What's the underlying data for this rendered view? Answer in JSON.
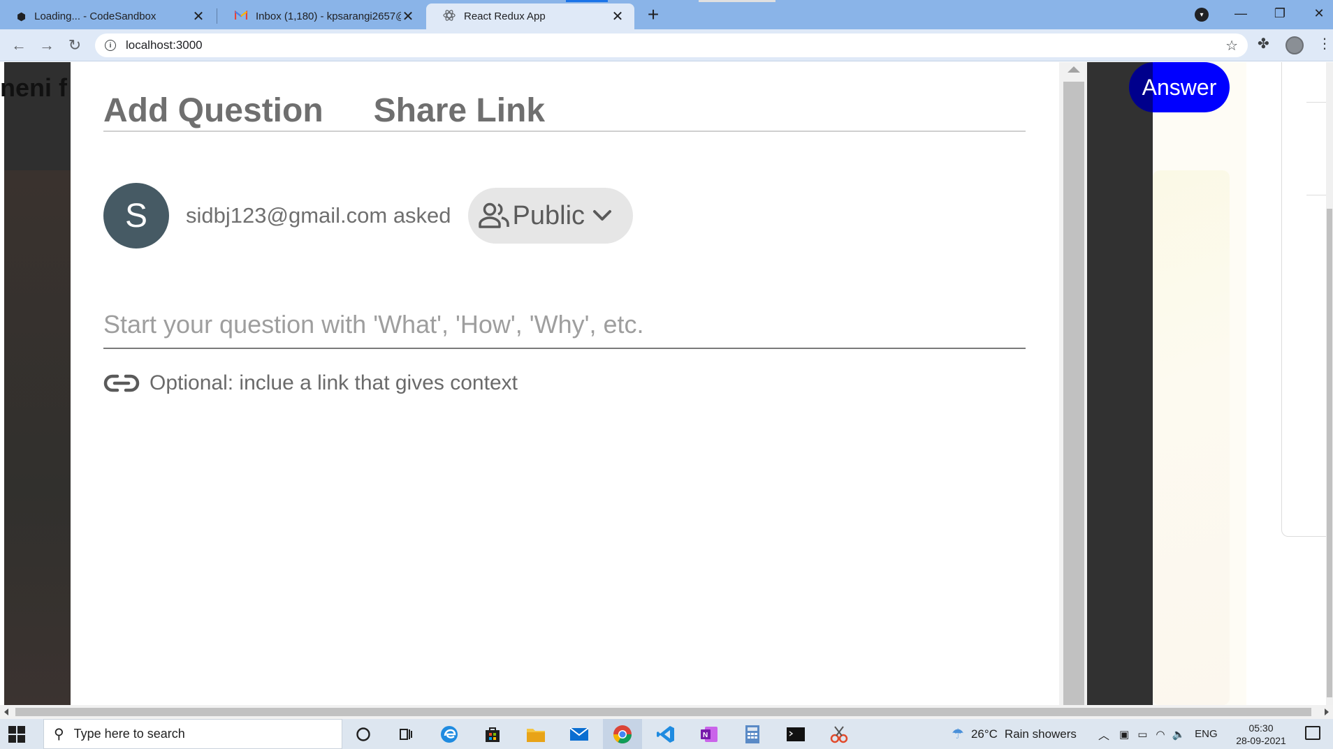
{
  "browser": {
    "tabs": [
      {
        "title": "Loading... - CodeSandbox",
        "icon": "codesandbox-icon",
        "active": false
      },
      {
        "title": "Inbox (1,180) - kpsarangi2657@g",
        "icon": "gmail-icon",
        "active": false
      },
      {
        "title": "React Redux App",
        "icon": "react-icon",
        "active": true
      }
    ],
    "close_glyph": "✕",
    "new_tab_glyph": "+",
    "url": "localhost:3000"
  },
  "background": {
    "left_text": "neni f",
    "answer_button": "Answer"
  },
  "modal": {
    "tabs": [
      "Add Question",
      "Share Link"
    ],
    "avatar_letter": "S",
    "asked_text": "sidbj123@gmail.com asked",
    "privacy": {
      "selected": "Public",
      "icon": "people-icon"
    },
    "question_placeholder": "Start your question with 'What', 'How', 'Why', etc.",
    "link_placeholder": "Optional: inclue a link that gives context"
  },
  "taskbar": {
    "search_placeholder": "Type here to search",
    "weather": {
      "temp": "26°C",
      "desc": "Rain showers"
    },
    "language": "ENG",
    "time": "05:30",
    "date": "28-09-2021"
  },
  "colors": {
    "answer_blue": "#0000ff",
    "avatar": "#465a64",
    "tab_strip": "#8ab4e8"
  }
}
